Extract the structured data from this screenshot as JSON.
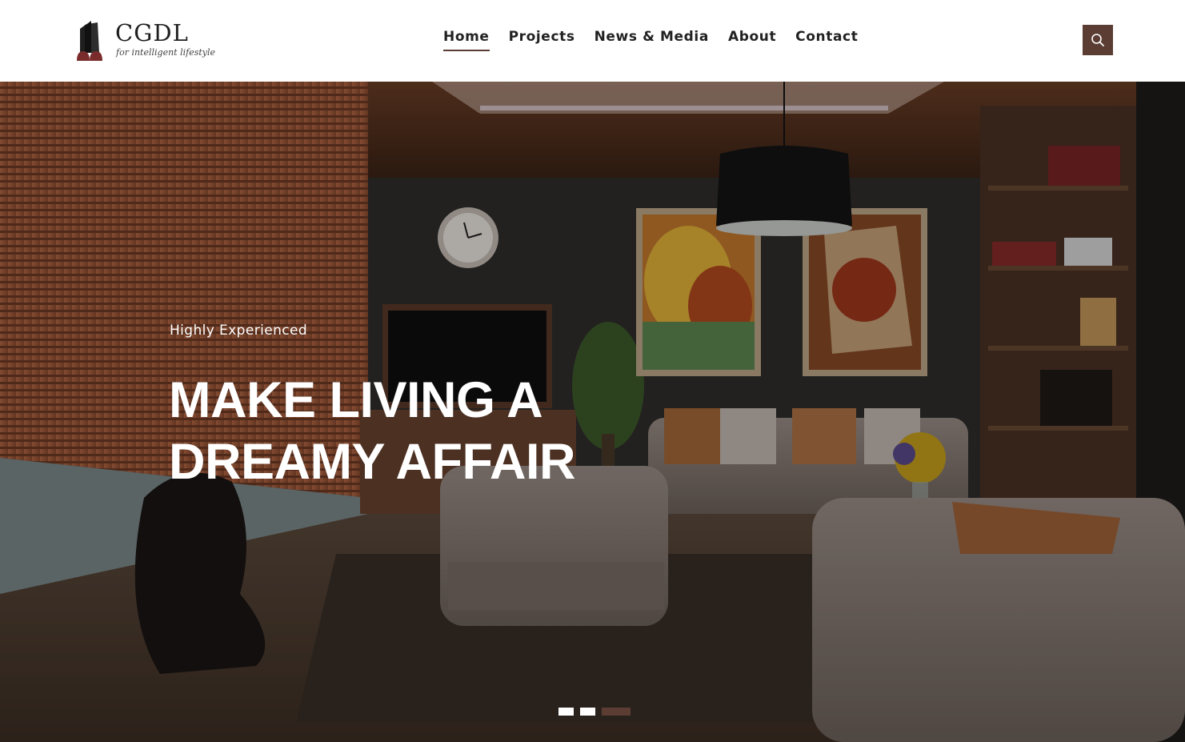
{
  "brand": {
    "name": "CGDL",
    "tagline": "for intelligent lifestyle"
  },
  "nav": {
    "items": [
      {
        "label": "Home",
        "active": true
      },
      {
        "label": "Projects",
        "active": false
      },
      {
        "label": "News & Media",
        "active": false
      },
      {
        "label": "About",
        "active": false
      },
      {
        "label": "Contact",
        "active": false
      }
    ]
  },
  "search": {
    "icon": "search-icon"
  },
  "hero": {
    "subtitle": "Highly Experienced",
    "title_line1": "MAKE LIVING A",
    "title_line2": "DREAMY AFFAIR",
    "slides": 3,
    "active_slide": 3
  },
  "colors": {
    "accent": "#5b3d34",
    "text_dark": "#222222",
    "white": "#ffffff"
  }
}
